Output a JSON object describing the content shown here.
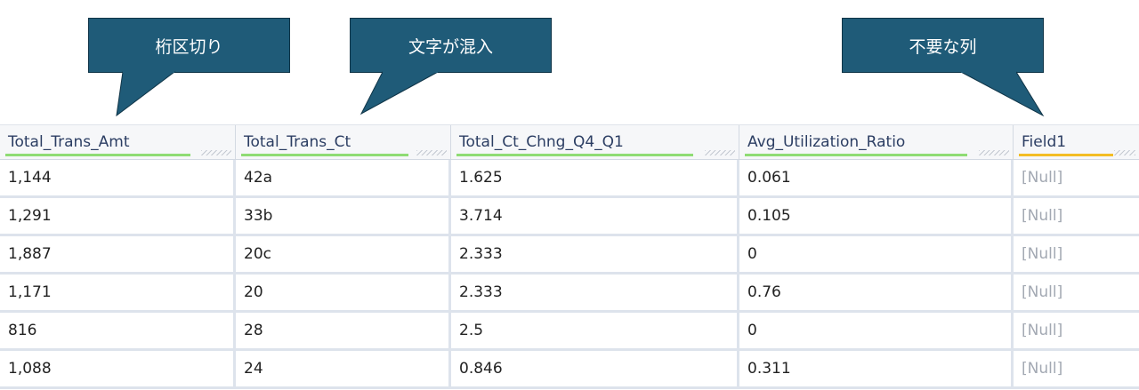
{
  "callouts": [
    {
      "label": "桁区切り"
    },
    {
      "label": "文字が混入"
    },
    {
      "label": "不要な列"
    }
  ],
  "table": {
    "columns": [
      "Total_Trans_Amt",
      "Total_Trans_Ct",
      "Total_Ct_Chng_Q4_Q1",
      "Avg_Utilization_Ratio",
      "Field1"
    ],
    "rows": [
      [
        "1,144",
        "42a",
        "1.625",
        "0.061",
        "[Null]"
      ],
      [
        "1,291",
        "33b",
        "3.714",
        "0.105",
        "[Null]"
      ],
      [
        "1,887",
        "20c",
        "2.333",
        "0",
        "[Null]"
      ],
      [
        "1,171",
        "20",
        "2.333",
        "0.76",
        "[Null]"
      ],
      [
        "816",
        "28",
        "2.5",
        "0",
        "[Null]"
      ],
      [
        "1,088",
        "24",
        "0.846",
        "0.311",
        "[Null]"
      ]
    ]
  },
  "colors": {
    "callout_bg": "#1f5b78",
    "header_underline_green": "#8fdc74",
    "header_underline_field": "#f3bd24",
    "null_text": "#a3a9b3"
  }
}
